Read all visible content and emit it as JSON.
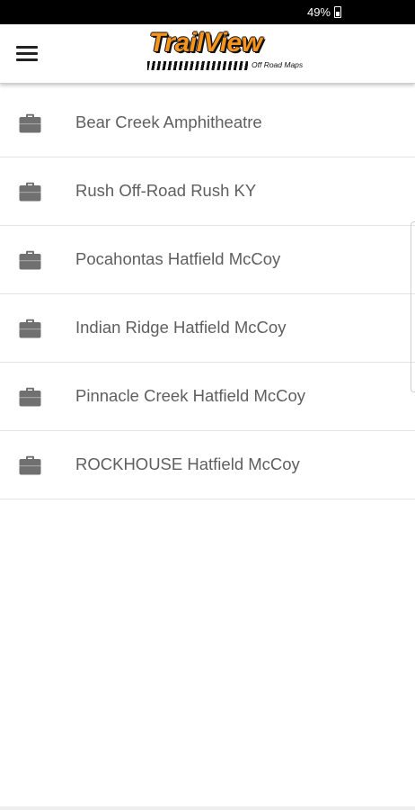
{
  "status_bar": {
    "battery_text": "49%",
    "battery_icon": "battery-icon"
  },
  "app_bar": {
    "menu_icon": "hamburger-menu-icon",
    "logo": {
      "title": "TrailView",
      "subtitle": "Off Road Maps",
      "accent_color": "#f7941d"
    }
  },
  "trail_list": {
    "item_icon": "briefcase-icon",
    "icon_color": "#707070",
    "items": [
      {
        "label": "Bear Creek Amphitheatre"
      },
      {
        "label": "Rush Off-Road Rush KY"
      },
      {
        "label": "Pocahontas Hatfield McCoy"
      },
      {
        "label": "Indian Ridge Hatfield McCoy"
      },
      {
        "label": "Pinnacle Creek Hatfield McCoy"
      },
      {
        "label": "ROCKHOUSE Hatfield McCoy"
      }
    ]
  }
}
